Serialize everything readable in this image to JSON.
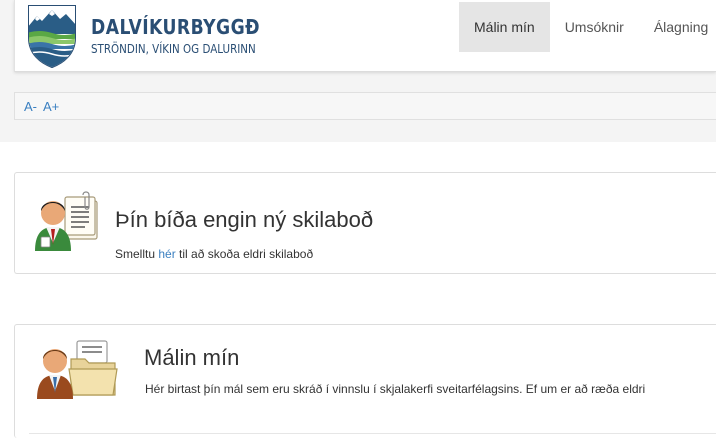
{
  "header": {
    "brand_name": "DALVÍKURBYGGÐ",
    "brand_tagline": "STRÖNDIN, VÍKIN OG DALURINN",
    "nav": [
      {
        "label": "Málin mín",
        "active": true
      },
      {
        "label": "Umsóknir",
        "active": false
      },
      {
        "label": "Álagning",
        "active": false
      }
    ]
  },
  "font_size_controls": {
    "decrease_label": "A-",
    "increase_label": "A+"
  },
  "messages_panel": {
    "title": "Þín bíða engin ný skilaboð",
    "text_before_link": "Smelltu ",
    "link_label": "hér",
    "text_after_link": " til að skoða eldri skilaboð"
  },
  "cases_panel": {
    "title": "Málin mín",
    "description": "Hér birtast þín mál sem eru skráð í vinnslu í skjalakerfi sveitarfélagsins. Ef um er að ræða eldri"
  },
  "colors": {
    "brand_blue": "#2a4e74",
    "link_blue": "#3a7fc0",
    "active_nav_bg": "#e5e5e5",
    "page_band_bg": "#f4f4f4"
  },
  "icons": {
    "logo": "municipal-crest-mountains-waves",
    "messages": "user-with-document-icon",
    "cases": "user-with-folder-icon"
  }
}
